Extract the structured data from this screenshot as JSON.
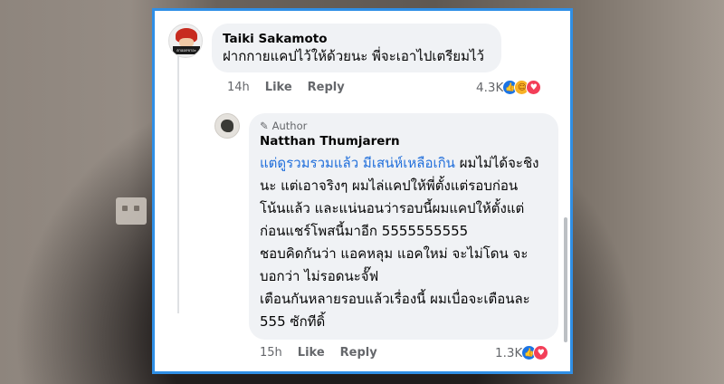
{
  "comments": [
    {
      "author": "Taiki Sakamoto",
      "avatar_badge": "ตาออกขาอะ",
      "text": "ฝากกายแคปไว้ให้ด้วยนะ พี่จะเอาไปเตรียมไว้",
      "time": "14h",
      "like_label": "Like",
      "reply_label": "Reply",
      "reaction_count": "4.3K",
      "reactions": [
        "like-icon",
        "care-icon",
        "love-icon"
      ]
    },
    {
      "author_tag": "Author",
      "author": "Natthan Thumjarern",
      "text_link": "แต่ดูรวมรวมแล้ว มีเสน่ห์เหลือเกิน",
      "text_lines": [
        " ผมไม่ได้จะชิง",
        "นะ แต่เอาจริงๆ ผมไล่แคปให้พี่ตั้งแต่รอบก่อน",
        "โน้นแล้ว    และแน่นอนว่ารอบนี้ผมแคปให้ตั้งแต่",
        "ก่อนแชร์โพสนี้มาอีก 5555555555",
        "ชอบคิดกันว่า แอคหลุม แอคใหม่ จะไม่โดน จะ",
        "บอกว่า ไม่รอดนะจั๊ฟ",
        "เตือนกันหลายรอบแล้วเรื่องนี้  ผมเบื่อจะเตือนละ",
        "555  ซักทีดิ้"
      ],
      "time": "15h",
      "like_label": "Like",
      "reply_label": "Reply",
      "reaction_count": "1.3K",
      "reactions": [
        "like-icon",
        "love-icon"
      ]
    }
  ],
  "colors": {
    "frame_border": "#2f8fe6",
    "bubble": "#f0f2f5",
    "link": "#216fdb"
  }
}
